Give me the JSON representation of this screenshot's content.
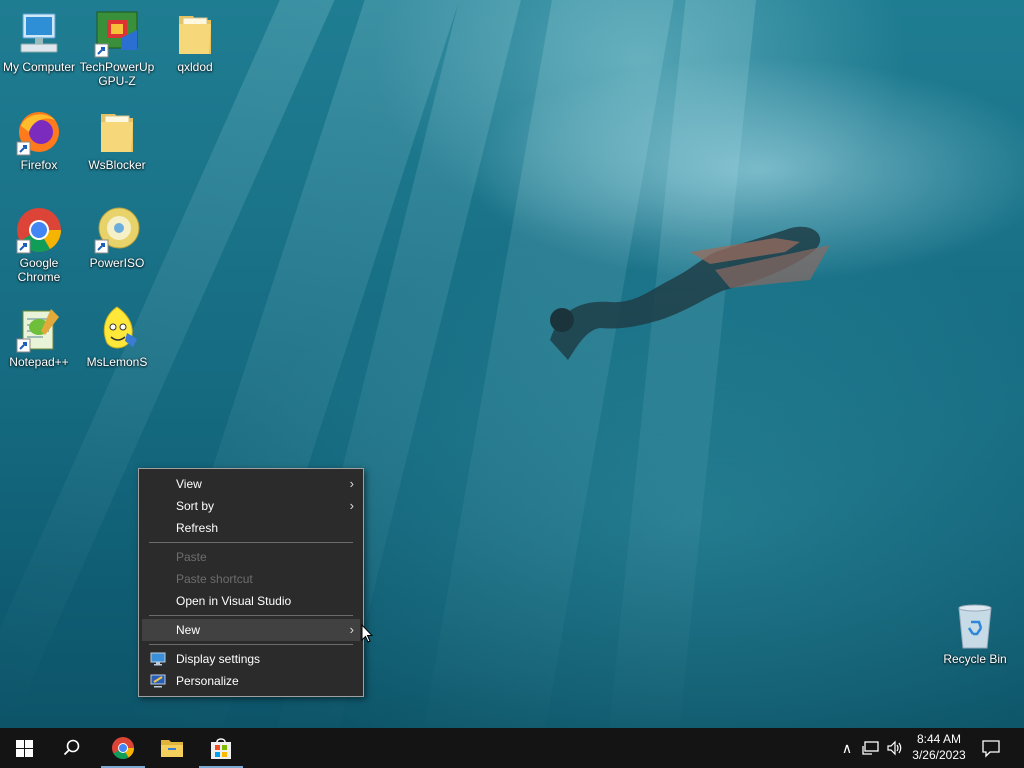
{
  "desktop": {
    "icons": [
      {
        "label": "My Computer",
        "icon": "computer-icon"
      },
      {
        "label": "TechPowerUp GPU-Z",
        "icon": "gpuz-icon"
      },
      {
        "label": "qxldod",
        "icon": "folder-icon"
      },
      {
        "label": "Firefox",
        "icon": "firefox-icon"
      },
      {
        "label": "WsBlocker",
        "icon": "folder-icon"
      },
      {
        "label": "Google Chrome",
        "icon": "chrome-icon"
      },
      {
        "label": "PowerISO",
        "icon": "poweriso-icon"
      },
      {
        "label": "Notepad++",
        "icon": "notepadpp-icon"
      },
      {
        "label": "MsLemonS",
        "icon": "lemon-icon"
      },
      {
        "label": "Recycle Bin",
        "icon": "recycle-bin-icon"
      }
    ]
  },
  "context_menu": {
    "items": [
      {
        "label": "View",
        "arrow": "›",
        "state": "enabled"
      },
      {
        "label": "Sort by",
        "arrow": "›",
        "state": "enabled"
      },
      {
        "label": "Refresh",
        "state": "enabled"
      },
      {
        "label": "Paste",
        "state": "disabled"
      },
      {
        "label": "Paste shortcut",
        "state": "disabled"
      },
      {
        "label": "Open in Visual Studio",
        "state": "enabled"
      },
      {
        "label": "New",
        "arrow": "›",
        "state": "hover"
      },
      {
        "label": "Display settings",
        "icon": "display-settings-icon",
        "state": "enabled"
      },
      {
        "label": "Personalize",
        "icon": "personalize-icon",
        "state": "enabled"
      }
    ]
  },
  "taskbar": {
    "buttons": [
      {
        "name": "start",
        "icon": "windows-logo-icon"
      },
      {
        "name": "search",
        "icon": "search-icon"
      },
      {
        "name": "chrome",
        "icon": "chrome-icon",
        "active": true
      },
      {
        "name": "file-explorer",
        "icon": "folder-icon"
      },
      {
        "name": "store",
        "icon": "store-icon",
        "active": true
      }
    ],
    "tray": {
      "chevron": "∧",
      "network": "network-icon",
      "volume": "volume-icon"
    },
    "clock": {
      "time": "8:44 AM",
      "date": "3/26/2023"
    },
    "notification": "notification-icon"
  },
  "colors": {
    "menu_bg": "#2b2b2b",
    "menu_hover": "#414141",
    "taskbar_bg": "#141414",
    "accent_underline": "#7da9d3"
  }
}
